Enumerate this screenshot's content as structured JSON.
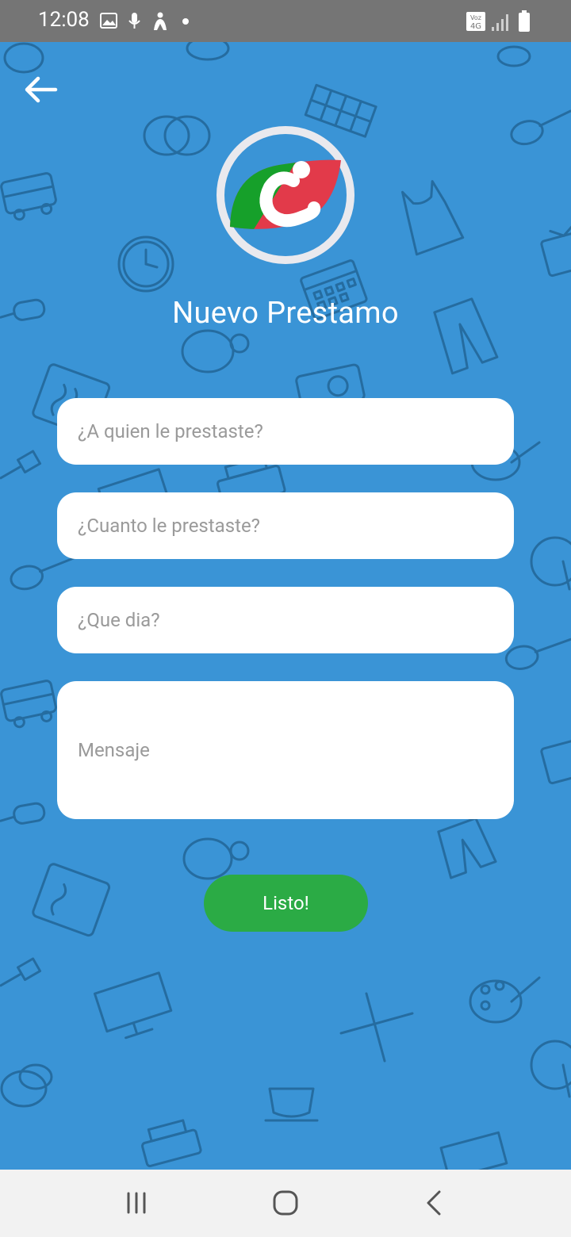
{
  "status_bar": {
    "time": "12:08",
    "icons_left": [
      "image-icon",
      "microphone-icon",
      "accessibility-icon",
      "dot-icon"
    ],
    "icons_right": [
      "volte-4g-icon",
      "signal-icon",
      "battery-icon"
    ],
    "network_label": "Voz 4G"
  },
  "header": {
    "back_icon": "arrow-left-icon",
    "logo": "app-logo",
    "title": "Nuevo Prestamo"
  },
  "form": {
    "borrower_placeholder": "¿A quien le prestaste?",
    "amount_placeholder": "¿Cuanto le prestaste?",
    "date_placeholder": "¿Que dia?",
    "message_placeholder": "Mensaje",
    "submit_label": "Listo!"
  },
  "colors": {
    "background": "#3a94d6",
    "status_bar": "#757575",
    "submit_button": "#2bab45",
    "logo_green": "#16a02a",
    "logo_red": "#e23a4a"
  },
  "nav_bar": {
    "items": [
      "recents-icon",
      "home-icon",
      "back-icon"
    ]
  }
}
